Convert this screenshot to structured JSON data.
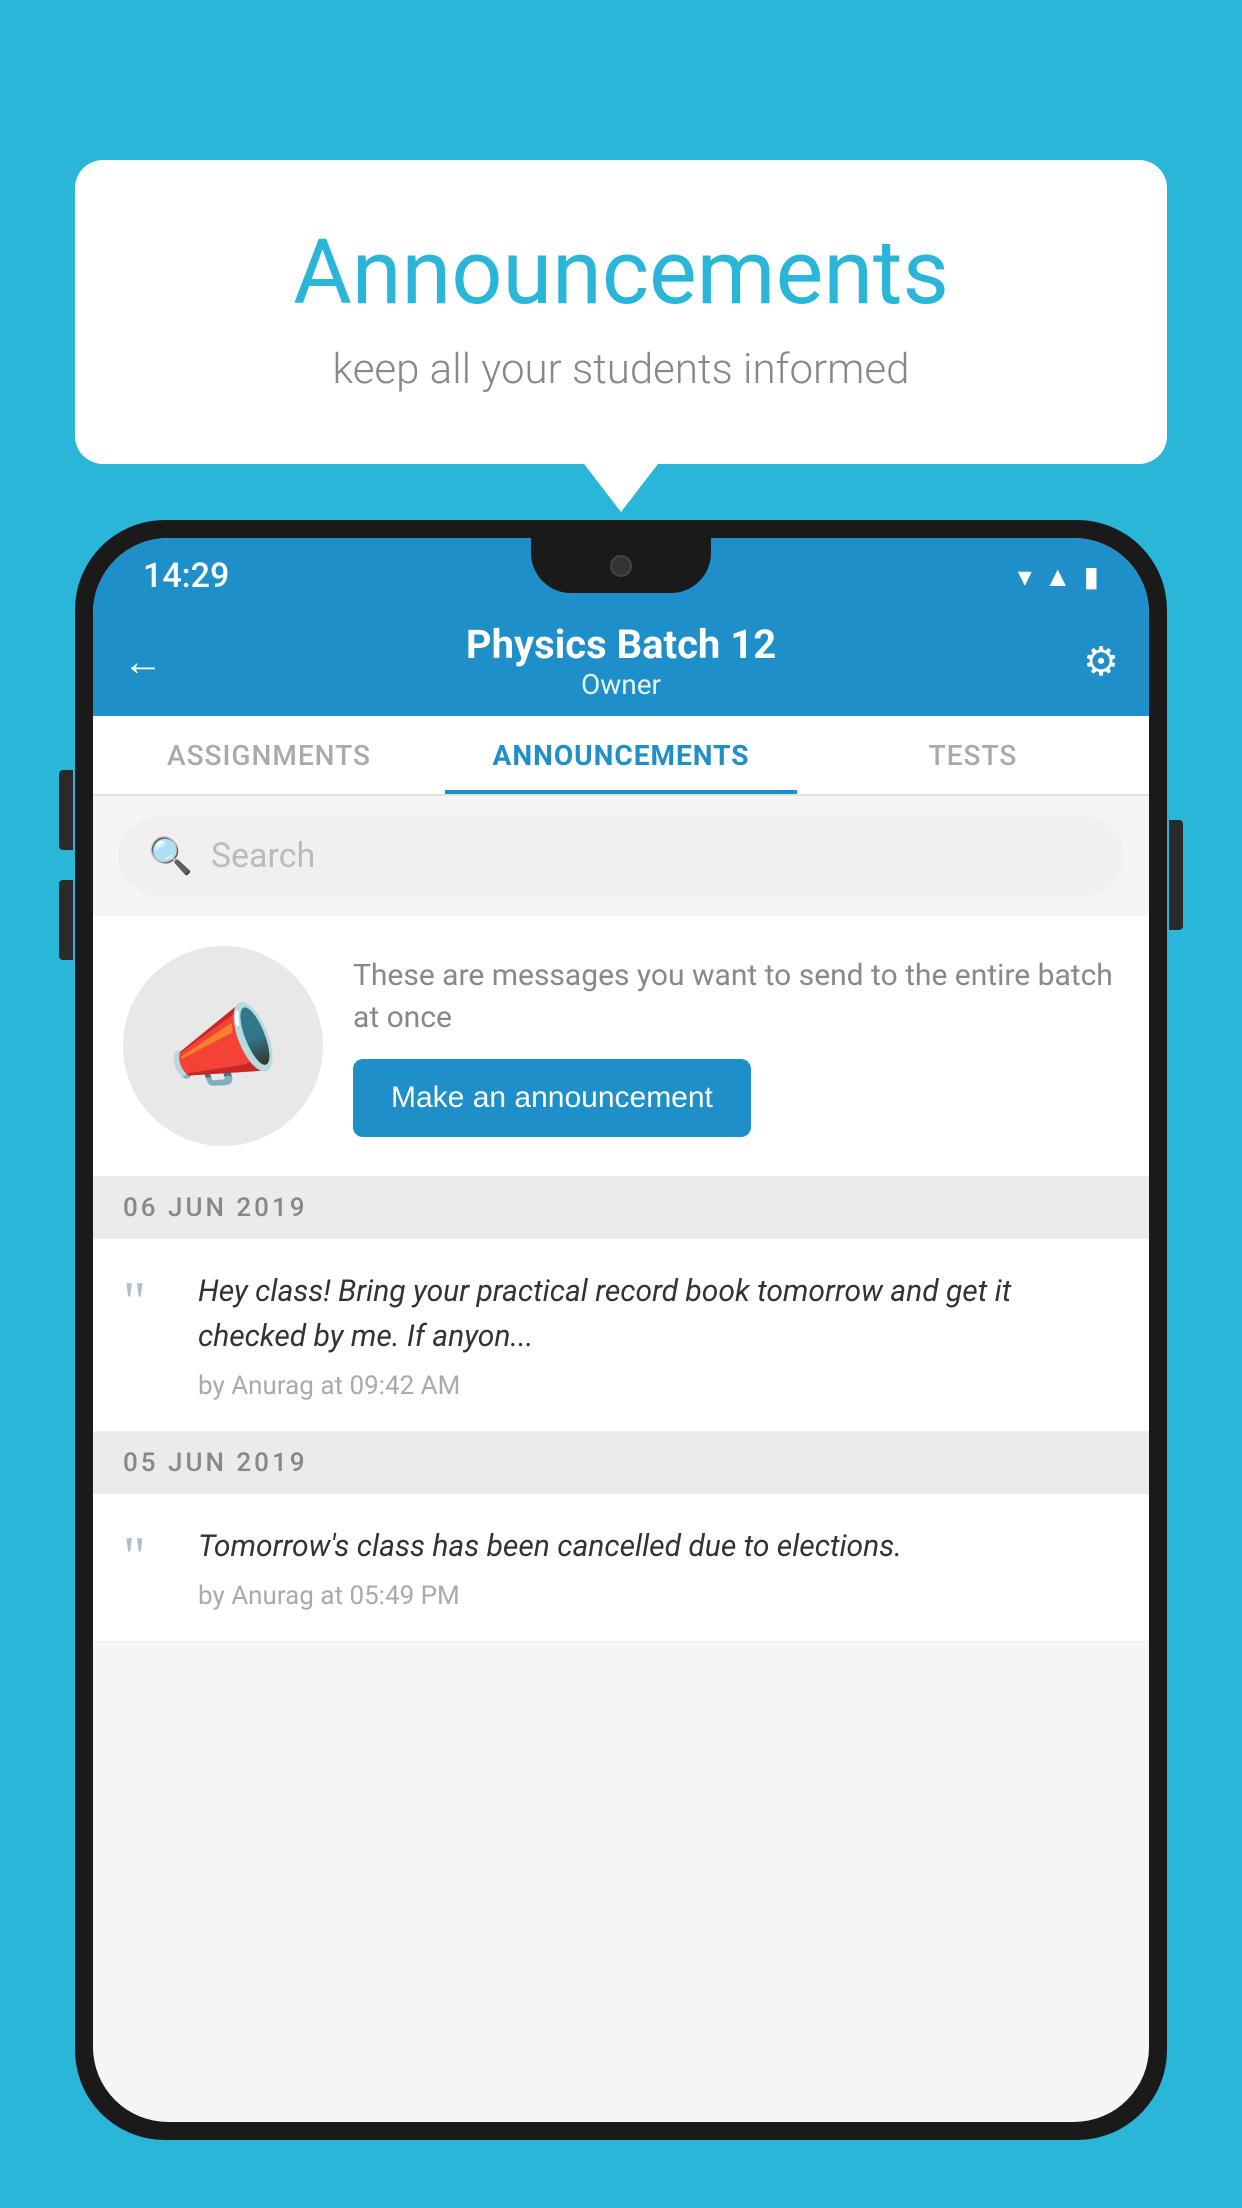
{
  "bubble": {
    "title": "Announcements",
    "subtitle": "keep all your students informed"
  },
  "phone": {
    "status": {
      "time": "14:29"
    },
    "header": {
      "title": "Physics Batch 12",
      "subtitle": "Owner",
      "back_label": "←",
      "gear_label": "⚙"
    },
    "tabs": [
      {
        "label": "ASSIGNMENTS",
        "active": false
      },
      {
        "label": "ANNOUNCEMENTS",
        "active": true
      },
      {
        "label": "TESTS",
        "active": false
      }
    ],
    "search": {
      "placeholder": "Search"
    },
    "promo": {
      "description": "These are messages you want to send to the entire batch at once",
      "button_label": "Make an announcement"
    },
    "dates": [
      {
        "label": "06  JUN  2019",
        "announcements": [
          {
            "text": "Hey class! Bring your practical record book tomorrow and get it checked by me. If anyon...",
            "meta": "by Anurag at 09:42 AM"
          }
        ]
      },
      {
        "label": "05  JUN  2019",
        "announcements": [
          {
            "text": "Tomorrow's class has been cancelled due to elections.",
            "meta": "by Anurag at 05:49 PM"
          }
        ]
      }
    ]
  }
}
